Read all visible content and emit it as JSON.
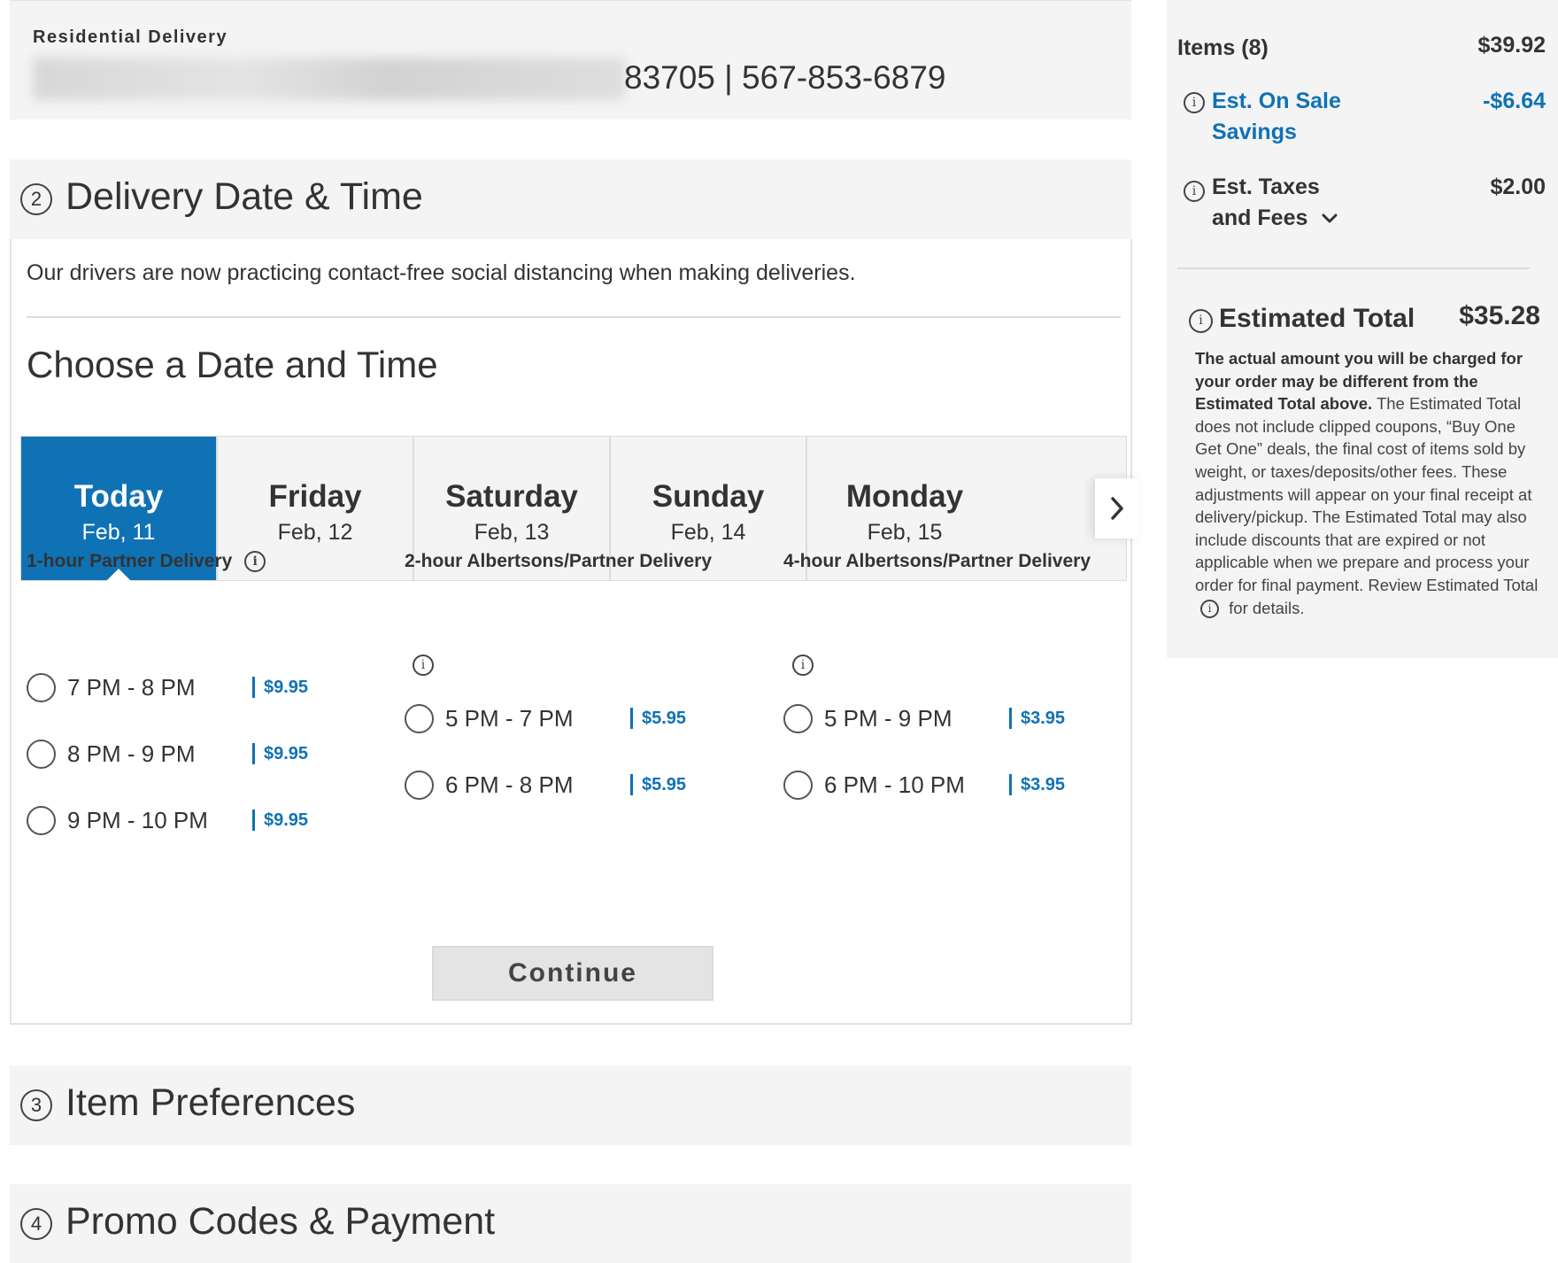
{
  "address": {
    "type_label": "Residential Delivery",
    "visible_tail": "83705 | 567-853-6879"
  },
  "sections": {
    "delivery": {
      "number": "2",
      "title": "Delivery Date & Time"
    },
    "item_prefs": {
      "number": "3",
      "title": "Item Preferences"
    },
    "promo": {
      "number": "4",
      "title": "Promo Codes & Payment"
    }
  },
  "delivery": {
    "note": "Our drivers are now practicing contact-free social distancing when making deliveries.",
    "choose_title": "Choose a Date and Time",
    "dates": [
      {
        "day": "Today",
        "date": "Feb, 11",
        "selected": true
      },
      {
        "day": "Friday",
        "date": "Feb, 12",
        "selected": false
      },
      {
        "day": "Saturday",
        "date": "Feb, 13",
        "selected": false
      },
      {
        "day": "Sunday",
        "date": "Feb, 14",
        "selected": false
      },
      {
        "day": "Monday",
        "date": "Feb, 15",
        "selected": false
      }
    ],
    "columns": [
      {
        "title": "1-hour Partner Delivery",
        "slots": [
          {
            "time": "7 PM - 8 PM",
            "price": "$9.95"
          },
          {
            "time": "8 PM - 9 PM",
            "price": "$9.95"
          },
          {
            "time": "9 PM - 10 PM",
            "price": "$9.95"
          }
        ]
      },
      {
        "title": "2-hour Albertsons/Partner Delivery",
        "slots": [
          {
            "time": "5 PM - 7 PM",
            "price": "$5.95"
          },
          {
            "time": "6 PM - 8 PM",
            "price": "$5.95"
          }
        ]
      },
      {
        "title": "4-hour Albertsons/Partner Delivery",
        "slots": [
          {
            "time": "5 PM - 9 PM",
            "price": "$3.95"
          },
          {
            "time": "6 PM - 10 PM",
            "price": "$3.95"
          }
        ]
      }
    ],
    "continue_label": "Continue"
  },
  "summary": {
    "items_label": "Items (8)",
    "items_value": "$39.92",
    "savings_label_1": "Est. On Sale",
    "savings_label_2": "Savings",
    "savings_value": "-$6.64",
    "taxes_label_1": "Est. Taxes",
    "taxes_label_2": "and Fees",
    "taxes_value": "$2.00",
    "total_label": "Estimated Total",
    "total_value": "$35.28",
    "disclaimer_bold": "The actual amount you will be charged for your order may be different from the Estimated Total above.",
    "disclaimer_text": "The Estimated Total does not include clipped coupons, “Buy One Get One” deals, the final cost of items sold by weight, or taxes/deposits/other fees. These adjustments will appear on your final receipt at delivery/pickup. The Estimated Total may also include discounts that are expired or not applicable when we prepare and process your order for final payment.",
    "disclaimer_review_pre": "Review Estimated Total",
    "disclaimer_review_post": "for details."
  },
  "icons": {
    "info": "info-circle-icon",
    "next": "chevron-right-icon",
    "expand": "chevron-down-icon"
  },
  "colors": {
    "accent": "#0f72b5",
    "panel_bg": "#f4f4f4",
    "text": "#333333"
  }
}
